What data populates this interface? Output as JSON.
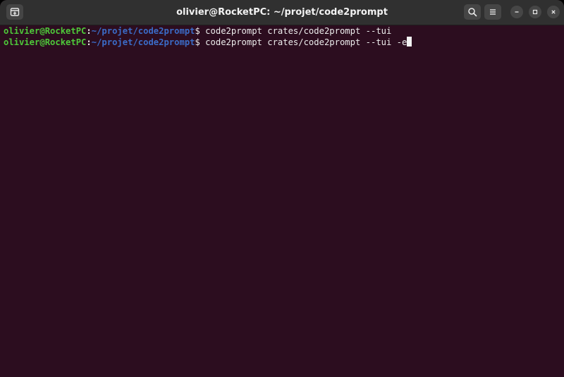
{
  "window": {
    "title": "olivier@RocketPC: ~/projet/code2prompt"
  },
  "header": {
    "new_tab_icon": "new-tab-icon",
    "search_icon": "search-icon",
    "menu_icon": "hamburger-menu-icon"
  },
  "terminal": {
    "background": "#2c0d1f",
    "lines": [
      {
        "user": "olivier@RocketPC",
        "colon": ":",
        "path": "~/projet/code2prompt",
        "dollar": "$",
        "command": " code2prompt crates/code2prompt --tui"
      },
      {
        "user": "olivier@RocketPC",
        "colon": ":",
        "path": "~/projet/code2prompt",
        "dollar": "$",
        "command": " code2prompt crates/code2prompt --tui -e"
      }
    ]
  },
  "colors": {
    "prompt_user": "#4ec93a",
    "prompt_path": "#3b6cc8",
    "titlebar": "#303030"
  }
}
